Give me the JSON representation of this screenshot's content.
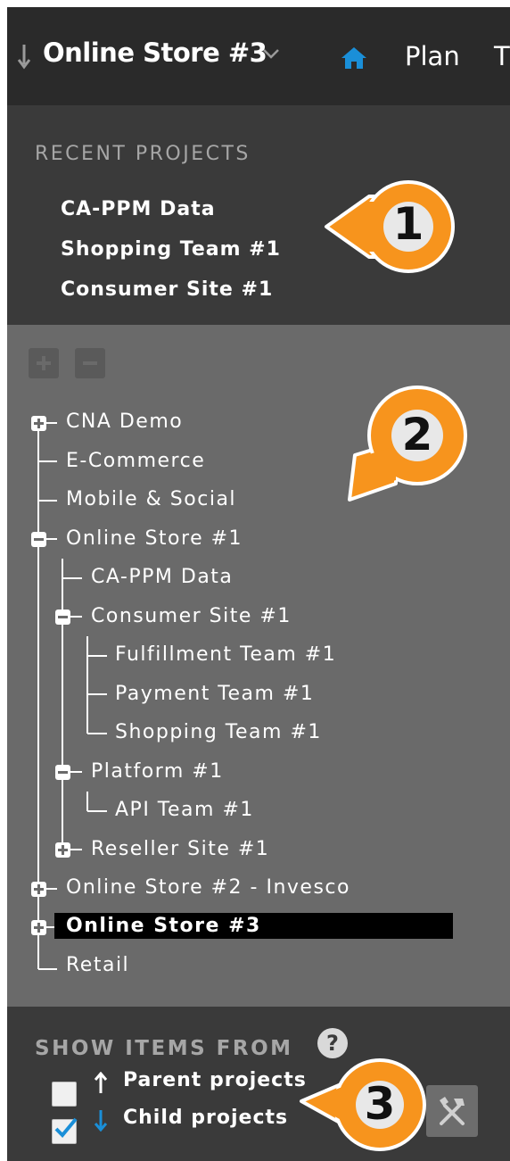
{
  "header": {
    "project_title": "Online Store #3",
    "nav": [
      "Plan",
      "T"
    ]
  },
  "recent": {
    "heading": "RECENT PROJECTS",
    "items": [
      "CA-PPM Data",
      "Shopping Team #1",
      "Consumer Site #1"
    ]
  },
  "tree": {
    "nodes": [
      {
        "label": "CNA Demo",
        "depth": 0,
        "toggle": "expand"
      },
      {
        "label": "E-Commerce",
        "depth": 0,
        "toggle": "none"
      },
      {
        "label": "Mobile & Social",
        "depth": 0,
        "toggle": "none"
      },
      {
        "label": "Online Store #1",
        "depth": 0,
        "toggle": "collapse"
      },
      {
        "label": "CA-PPM Data",
        "depth": 1,
        "toggle": "none"
      },
      {
        "label": "Consumer Site #1",
        "depth": 1,
        "toggle": "collapse"
      },
      {
        "label": "Fulfillment Team #1",
        "depth": 2,
        "toggle": "none"
      },
      {
        "label": "Payment Team #1",
        "depth": 2,
        "toggle": "none"
      },
      {
        "label": "Shopping Team #1",
        "depth": 2,
        "toggle": "none"
      },
      {
        "label": "Platform #1",
        "depth": 1,
        "toggle": "collapse"
      },
      {
        "label": "API Team #1",
        "depth": 2,
        "toggle": "none"
      },
      {
        "label": "Reseller Site #1",
        "depth": 1,
        "toggle": "expand"
      },
      {
        "label": "Online Store #2 - Invesco",
        "depth": 0,
        "toggle": "expand"
      },
      {
        "label": "Online Store #3",
        "depth": 0,
        "toggle": "expand",
        "selected": true
      },
      {
        "label": "Retail",
        "depth": 0,
        "toggle": "none"
      }
    ]
  },
  "show_items": {
    "heading": "SHOW ITEMS FROM",
    "help_icon": "?",
    "options": [
      {
        "label": "Parent projects",
        "checked": false,
        "arrow": "up"
      },
      {
        "label": "Child projects",
        "checked": true,
        "arrow": "down"
      }
    ]
  },
  "callouts": [
    "1",
    "2",
    "3"
  ],
  "colors": {
    "accent_blue": "#1a8fd8",
    "callout_orange": "#f7941d",
    "selected_bg": "#000000"
  },
  "icons": [
    "sort-arrow-icon",
    "chevron-down-icon",
    "home-icon",
    "plus-icon",
    "minus-icon",
    "help-icon",
    "up-arrow-icon",
    "down-arrow-icon",
    "tools-icon"
  ]
}
